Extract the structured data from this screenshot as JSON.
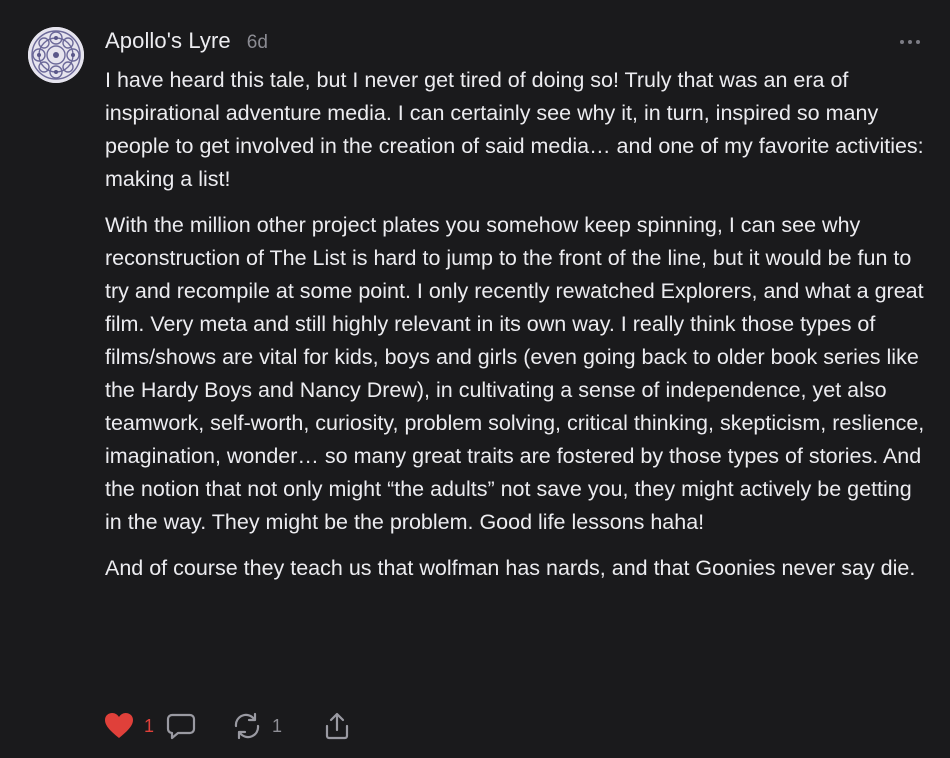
{
  "comment": {
    "author": "Apollo's Lyre",
    "timestamp": "6d",
    "paragraphs": [
      "I have heard this tale, but I never get tired of doing so! Truly that was an era of inspirational adventure media. I can certainly see why it, in turn, inspired so many people to get involved in the creation of said media… and one of my favorite activities: making a list!",
      "With the million other project plates you somehow keep spinning, I can see why reconstruction of The List is hard to jump to the front of the line, but it would be fun to try and recompile at some point. I only recently rewatched Explorers, and what a great film. Very meta and still highly relevant in its own way. I really think those types of films/shows are vital for kids, boys and girls (even going back to older book series like the Hardy Boys and Nancy Drew), in cultivating a sense of independence, yet also teamwork, self-worth, curiosity, problem solving, critical thinking, skepticism, reslience, imagination, wonder… so many great traits are fostered by those types of stories. And the notion that not only might “the adults” not save you, they might actively be getting in the way. They might be the problem. Good life lessons haha!",
      "And of course they teach us that wolfman has nards, and that Goonies never say die."
    ],
    "actions": {
      "like_count": "1",
      "restack_count": "1"
    },
    "icons": {
      "like": "heart-icon",
      "reply": "speech-bubble-icon",
      "restack": "restack-icon",
      "share": "share-icon",
      "more": "more-horizontal-icon"
    },
    "colors": {
      "background": "#1a1a1c",
      "like_red": "#e0403a",
      "muted": "#8b8b92"
    }
  }
}
